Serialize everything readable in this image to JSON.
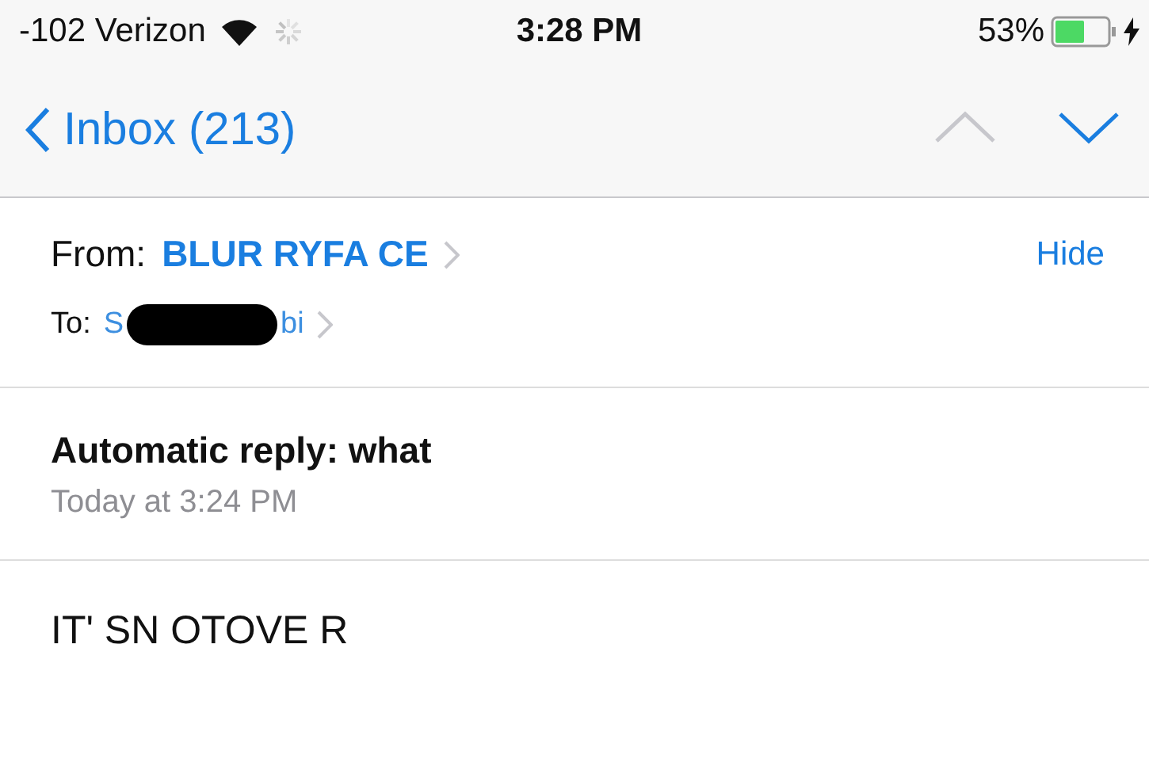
{
  "status_bar": {
    "carrier": "-102 Verizon",
    "time": "3:28 PM",
    "battery": "53%"
  },
  "nav_bar": {
    "back_label": "Inbox (213)",
    "arrows": [
      {
        "kind": "up",
        "disabled": true
      },
      {
        "kind": "down",
        "disabled": false
      }
    ]
  },
  "header": {
    "from_label": "From:",
    "from_name": "BLUR RYFA CE",
    "hide": "Hide",
    "to_label": "To:",
    "to_start": "S",
    "to_end": "bi"
  },
  "subject": "Automatic reply: what",
  "date": "Today at 3:24 PM",
  "body": "IT' SN OTOVE R"
}
